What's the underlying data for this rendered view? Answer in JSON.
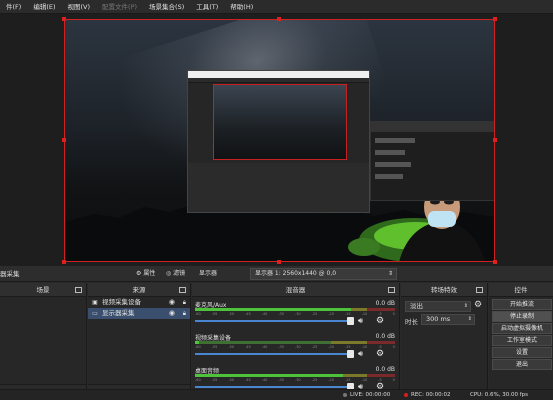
{
  "menu": [
    {
      "label": "件(F)",
      "enabled": true
    },
    {
      "label": "编辑(E)",
      "enabled": true
    },
    {
      "label": "视图(V)",
      "enabled": true
    },
    {
      "label": "配置文件(P)",
      "enabled": false
    },
    {
      "label": "场景集合(S)",
      "enabled": true
    },
    {
      "label": "工具(T)",
      "enabled": true
    },
    {
      "label": "帮助(H)",
      "enabled": true
    }
  ],
  "source_toolbar": {
    "current_source": "器采集",
    "properties_label": "属性",
    "filters_label": "滤镜",
    "display_label": "显示器",
    "display_value": "显示器 1: 2560x1440 @ 0,0"
  },
  "scenes": {
    "title": "场景"
  },
  "sources": {
    "title": "来源",
    "items": [
      {
        "label": "视频采集设备",
        "icon": "camera-icon"
      },
      {
        "label": "显示器采集",
        "icon": "monitor-icon"
      }
    ]
  },
  "mixer": {
    "title": "混音器",
    "scale": [
      "-60",
      "-55",
      "-50",
      "-45",
      "-40",
      "-35",
      "-30",
      "-25",
      "-20",
      "-15",
      "-10",
      "-5",
      "0"
    ],
    "channels": [
      {
        "name": "麦克风/Aux",
        "db": "0.0 dB",
        "level": 0.78
      },
      {
        "name": "视频采集设备",
        "db": "0.0 dB",
        "level": 0.02
      },
      {
        "name": "桌面音频",
        "db": "0.0 dB",
        "level": 0.74
      }
    ]
  },
  "transitions": {
    "title": "转场特效",
    "type": "淡出",
    "duration_label": "时长",
    "duration_value": "300 ms"
  },
  "controls": {
    "title": "控件",
    "buttons": [
      {
        "label": "开始推流",
        "active": false
      },
      {
        "label": "停止录制",
        "active": true
      },
      {
        "label": "启动虚拟摄像机",
        "active": false
      },
      {
        "label": "工作室模式",
        "active": false
      },
      {
        "label": "设置",
        "active": false
      },
      {
        "label": "退出",
        "active": false
      }
    ]
  },
  "status": {
    "live_label": "LIVE: 00:00:00",
    "rec_label": "REC: 00:00:02",
    "cpu_label": "CPU: 0.6%, 30.00 fps"
  },
  "colors": {
    "selection": "#d02020",
    "slider": "#4a85cf",
    "rec_dot": "#d02020",
    "selected_row": "#3a4f6e"
  }
}
